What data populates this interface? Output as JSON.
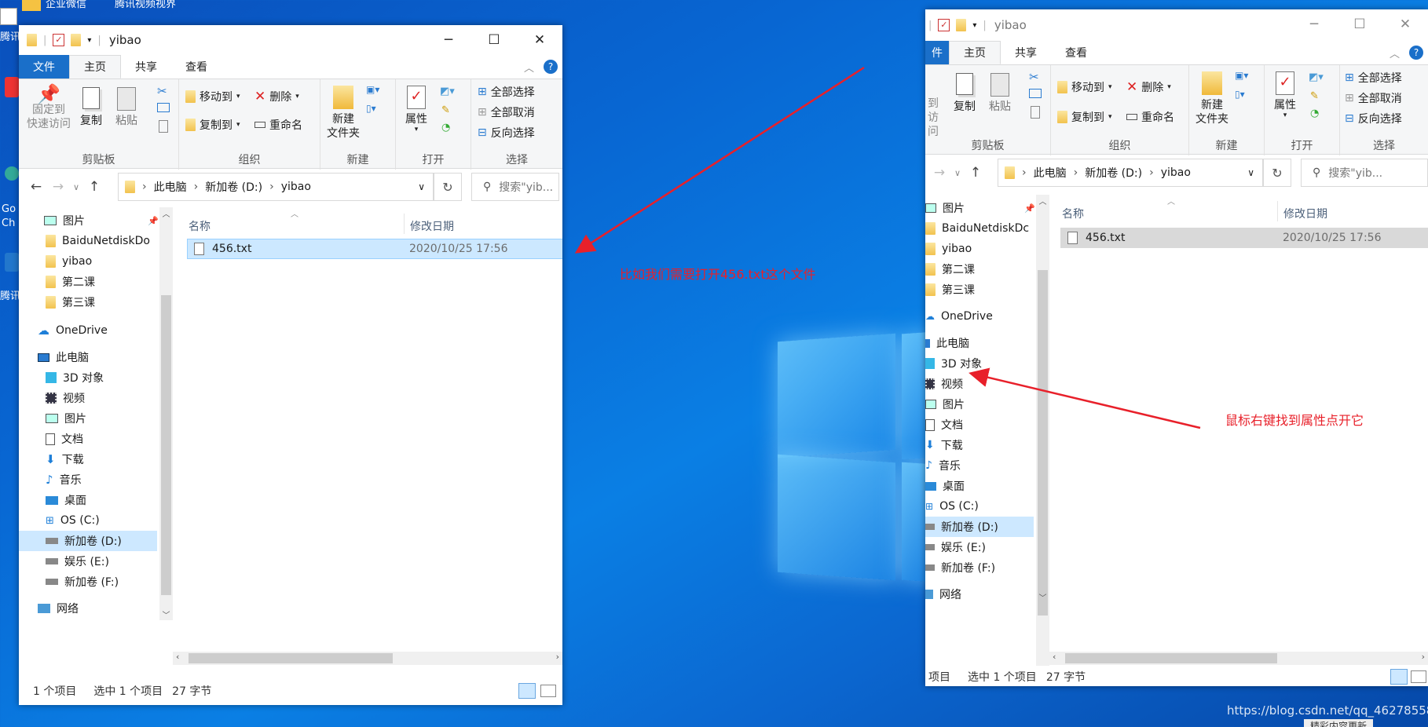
{
  "desktop": {
    "icon_labels": [
      "腾讯",
      "Go Ch",
      "腾讯"
    ],
    "top_labels": [
      "企业微信",
      "腾讯视频视界"
    ],
    "watermark": "https://blog.csdn.net/qq_46278558",
    "bottom_text": "精彩内容更新"
  },
  "left_window": {
    "title": "yibao",
    "tabs": [
      "文件",
      "主页",
      "共享",
      "查看"
    ],
    "ribbon": {
      "clipboard": {
        "label": "剪贴板",
        "pin": "固定到\n快速访问",
        "copy": "复制",
        "paste": "粘贴"
      },
      "organize": {
        "label": "组织",
        "move": "移动到",
        "copyto": "复制到",
        "delete": "删除",
        "rename": "重命名"
      },
      "new": {
        "label": "新建",
        "folder": "新建\n文件夹"
      },
      "open": {
        "label": "打开",
        "props": "属性"
      },
      "select": {
        "label": "选择",
        "all": "全部选择",
        "none": "全部取消",
        "invert": "反向选择"
      }
    },
    "path": [
      "此电脑",
      "新加卷 (D:)",
      "yibao"
    ],
    "search_placeholder": "搜索\"yib...",
    "nav": [
      "图片",
      "BaiduNetdiskDo",
      "yibao",
      "第二课",
      "第三课",
      "OneDrive",
      "此电脑",
      "3D 对象",
      "视频",
      "图片",
      "文档",
      "下载",
      "音乐",
      "桌面",
      "OS (C:)",
      "新加卷 (D:)",
      "娱乐 (E:)",
      "新加卷 (F:)",
      "网络"
    ],
    "columns": {
      "name": "名称",
      "date": "修改日期"
    },
    "file": {
      "name": "456.txt",
      "date": "2020/10/25 17:56"
    },
    "status": {
      "count": "1 个项目",
      "selected": "选中 1 个项目",
      "size": "27 字节"
    }
  },
  "right_window": {
    "title": "yibao",
    "tabs": [
      "件",
      "主页",
      "共享",
      "查看"
    ],
    "ribbon": {
      "clipboard": {
        "label": "剪贴板",
        "pin": "到\n访问",
        "copy": "复制",
        "paste": "粘贴"
      },
      "organize": {
        "label": "组织",
        "move": "移动到",
        "copyto": "复制到",
        "delete": "删除",
        "rename": "重命名"
      },
      "new": {
        "label": "新建",
        "folder": "新建\n文件夹"
      },
      "open": {
        "label": "打开",
        "props": "属性"
      },
      "select": {
        "label": "选择",
        "all": "全部选择",
        "none": "全部取消",
        "invert": "反向选择"
      }
    },
    "path": [
      "此电脑",
      "新加卷 (D:)",
      "yibao"
    ],
    "search_placeholder": "搜索\"yib...",
    "nav": [
      "图片",
      "BaiduNetdiskDc",
      "yibao",
      "第二课",
      "第三课",
      "OneDrive",
      "此电脑",
      "3D 对象",
      "视频",
      "图片",
      "文档",
      "下载",
      "音乐",
      "桌面",
      "OS (C:)",
      "新加卷 (D:)",
      "娱乐 (E:)",
      "新加卷 (F:)",
      "网络"
    ],
    "columns": {
      "name": "名称",
      "date": "修改日期"
    },
    "file": {
      "name": "456.txt",
      "date": "2020/10/25 17:56"
    },
    "status": {
      "count": "项目",
      "selected": "选中 1 个项目",
      "size": "27 字节"
    }
  },
  "annotations": {
    "first": "比如我们需要打开456.txt这个文件",
    "second": "鼠标右键找到属性点开它"
  },
  "colors": {
    "annotation": "#e8202a",
    "file_tab": "#1a6fc9",
    "selection": "#cce8ff"
  }
}
